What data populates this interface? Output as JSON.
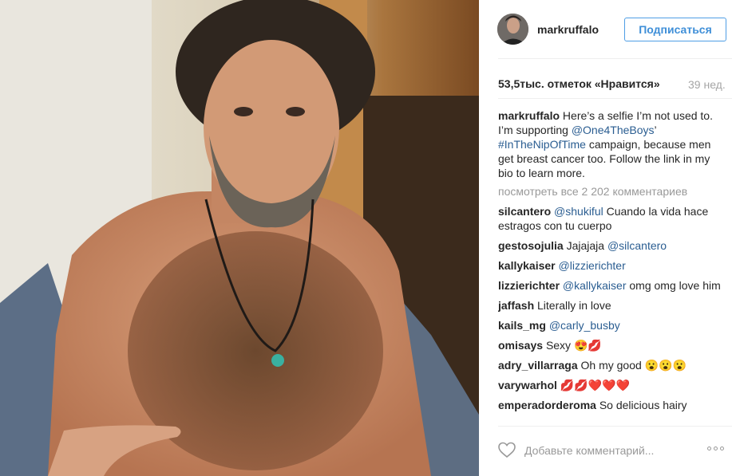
{
  "post": {
    "username": "markruffalo",
    "follow_label": "Подписаться",
    "likes": "53,5тыс. отметок «Нравится»",
    "age": "39 нед.",
    "caption_user": "markruffalo",
    "caption_parts": [
      {
        "text": "Here’s a selfie I’m not used to. I’m supporting ",
        "link": false
      },
      {
        "text": "@One4TheBoys",
        "link": true
      },
      {
        "text": "’ ",
        "link": false
      },
      {
        "text": "#InTheNipOfTime",
        "link": true
      },
      {
        "text": " campaign, because men get breast cancer too. Follow the link in my bio to learn more.",
        "link": false
      }
    ],
    "view_all": "посмотреть все 2 202 комментариев",
    "comments": [
      {
        "user": "silcantero",
        "parts": [
          {
            "text": "@shukiful",
            "link": true
          },
          {
            "text": " Cuando la vida hace estragos con tu cuerpo",
            "link": false
          }
        ]
      },
      {
        "user": "gestosojulia",
        "parts": [
          {
            "text": "Jajajaja ",
            "link": false
          },
          {
            "text": "@silcantero",
            "link": true
          }
        ]
      },
      {
        "user": "kallykaiser",
        "parts": [
          {
            "text": "@lizzierichter",
            "link": true
          }
        ]
      },
      {
        "user": "lizzierichter",
        "parts": [
          {
            "text": "@kallykaiser",
            "link": true
          },
          {
            "text": " omg omg love him",
            "link": false
          }
        ]
      },
      {
        "user": "jaffash",
        "parts": [
          {
            "text": "Literally in love",
            "link": false
          }
        ]
      },
      {
        "user": "kails_mg",
        "parts": [
          {
            "text": "@carly_busby",
            "link": true
          }
        ]
      },
      {
        "user": "omisays",
        "parts": [
          {
            "text": "Sexy 😍💋",
            "link": false
          }
        ]
      },
      {
        "user": "adry_villarraga",
        "parts": [
          {
            "text": "Oh my good 😮😮😮",
            "link": false
          }
        ]
      },
      {
        "user": "varywarhol",
        "parts": [
          {
            "text": "💋💋❤️❤️❤️",
            "link": false
          }
        ]
      },
      {
        "user": "emperadorderoma",
        "parts": [
          {
            "text": "So delicious hairy",
            "link": false
          }
        ]
      }
    ],
    "add_comment_placeholder": "Добавьте комментарий...",
    "icons": {
      "like": "heart-icon",
      "more": "more-options-icon",
      "avatar": "avatar"
    },
    "colors": {
      "accent": "#3f8fd8",
      "link": "#2a5d91",
      "muted": "#999999"
    }
  }
}
